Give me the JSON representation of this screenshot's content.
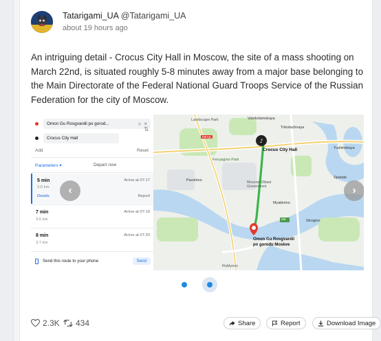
{
  "post": {
    "author_name": "Tatarigami_UA",
    "author_handle": "@Tatarigami_UA",
    "time": "about 19 hours ago",
    "text": "An intriguing detail - Crocus City Hall in Moscow, the site of a mass shooting on March 22nd, is situated roughly 5-8 minutes away from a major base belonging to the Main Directorate of the Federal National Guard Troops Service of the Russian Federation for the city of Moscow."
  },
  "route_panel": {
    "from": "Omon Gu Rosgvardii po gorod...",
    "to": "Crocus City Hall",
    "add_label": "Add",
    "reset_label": "Reset",
    "parameters_label": "Parameters ▾",
    "depart_label": "Depart now",
    "routes": [
      {
        "duration": "5 min",
        "distance": "3.6 km",
        "arrive": "Arrive at 07:17",
        "details": "Details",
        "report": "Report"
      },
      {
        "duration": "7 min",
        "distance": "3.6 km",
        "arrive": "Arrive at 07:19"
      },
      {
        "duration": "8 min",
        "distance": "3.7 km",
        "arrive": "Arrive at 07:20"
      }
    ],
    "send_label": "Send this route to your phone",
    "send_button": "Send"
  },
  "map": {
    "labels": {
      "landscape_park": "Landscape Park",
      "volokolamskaya": "Volokolamskaya",
      "trikotazhnaya": "Trikotazhnaya",
      "crocus": "Crocus City Hall",
      "fenyagino": "Fenyagino Park",
      "pavshino": "Pavshino",
      "moscow_oblast_gov": "Moscow Oblast Government",
      "myakinino": "Myakinino",
      "tushinskaya": "Tushinskaya",
      "spartak": "Spartak",
      "strogino": "Strogino",
      "omon_line1": "Omon Gu Rosgvardii",
      "omon_line2": "po gorodu Moskve",
      "rublyovo": "Rublyovo",
      "road_mkad": "МКАД",
      "road_num": "М9"
    }
  },
  "carousel": {
    "slide_count": 2,
    "active_index": 1
  },
  "stats": {
    "likes": "2.3K",
    "reposts": "434"
  },
  "actions": {
    "share": "Share",
    "report": "Report",
    "download": "Download Image"
  },
  "colors": {
    "accent": "#1f8ae6",
    "route_green": "#3bb54a",
    "map_water": "#b9d7f0",
    "map_park": "#c9e8b5"
  }
}
